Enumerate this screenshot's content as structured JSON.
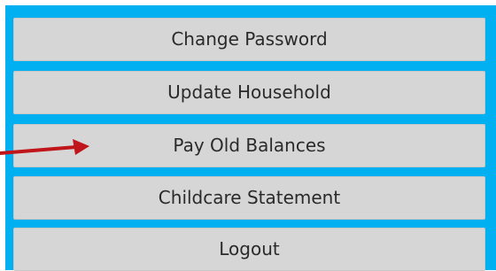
{
  "menu": {
    "items": [
      {
        "label": "Change Password"
      },
      {
        "label": "Update Household"
      },
      {
        "label": "Pay Old Balances"
      },
      {
        "label": "Childcare Statement"
      },
      {
        "label": "Logout"
      }
    ]
  },
  "annotation": {
    "arrow_color": "#c0151b",
    "points_to": "Pay Old Balances"
  },
  "colors": {
    "panel_background": "#00b0f0",
    "button_background": "#d6d6d6",
    "button_text": "#2a2a2a"
  }
}
